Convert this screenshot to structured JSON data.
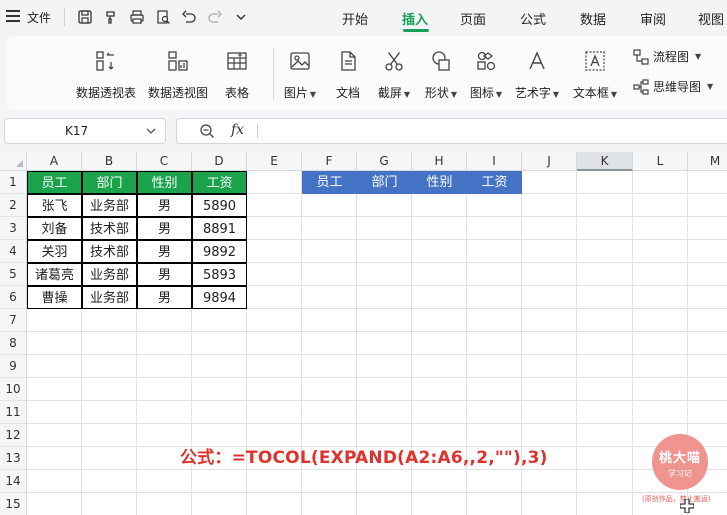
{
  "menubar": {
    "file_label": "文件",
    "tabs": [
      "开始",
      "插入",
      "页面",
      "公式",
      "数据",
      "审阅",
      "视图"
    ],
    "active_tab": "插入"
  },
  "ribbon": {
    "big_buttons": [
      "数据透视表",
      "数据透视图",
      "表格",
      "图片",
      "文档",
      "截屏",
      "形状",
      "图标",
      "艺术字",
      "文本框"
    ],
    "small_buttons": [
      "流程图",
      "思维导图"
    ]
  },
  "formula_bar": {
    "name_box": "K17",
    "fx_label": "fx",
    "formula": ""
  },
  "grid": {
    "columns": [
      "A",
      "B",
      "C",
      "D",
      "E",
      "F",
      "G",
      "H",
      "I",
      "J",
      "K",
      "L",
      "M"
    ],
    "selected_column": "K",
    "rows": [
      "1",
      "2",
      "3",
      "4",
      "5",
      "6",
      "7",
      "8",
      "9",
      "10",
      "11",
      "12",
      "13",
      "14",
      "15"
    ]
  },
  "source_table": {
    "headers": [
      "员工",
      "部门",
      "性别",
      "工资"
    ],
    "rows": [
      [
        "张飞",
        "业务部",
        "男",
        "5890"
      ],
      [
        "刘备",
        "技术部",
        "男",
        "8891"
      ],
      [
        "关羽",
        "技术部",
        "男",
        "9892"
      ],
      [
        "诸葛亮",
        "业务部",
        "男",
        "5893"
      ],
      [
        "曹操",
        "业务部",
        "男",
        "9894"
      ]
    ],
    "header_color": "#1aa34a"
  },
  "result_headers": {
    "headers": [
      "员工",
      "部门",
      "性别",
      "工资"
    ],
    "header_color": "#4472c4"
  },
  "formula_note": "公式：=TOCOL(EXPAND(A2:A6,,2,\"\"),3)",
  "watermark": {
    "title": "桃大喵",
    "subtitle": "学习记",
    "note": "(原创作品，禁止搬运)"
  },
  "colors": {
    "accent": "#18a058",
    "formula_text": "#e0322d"
  }
}
